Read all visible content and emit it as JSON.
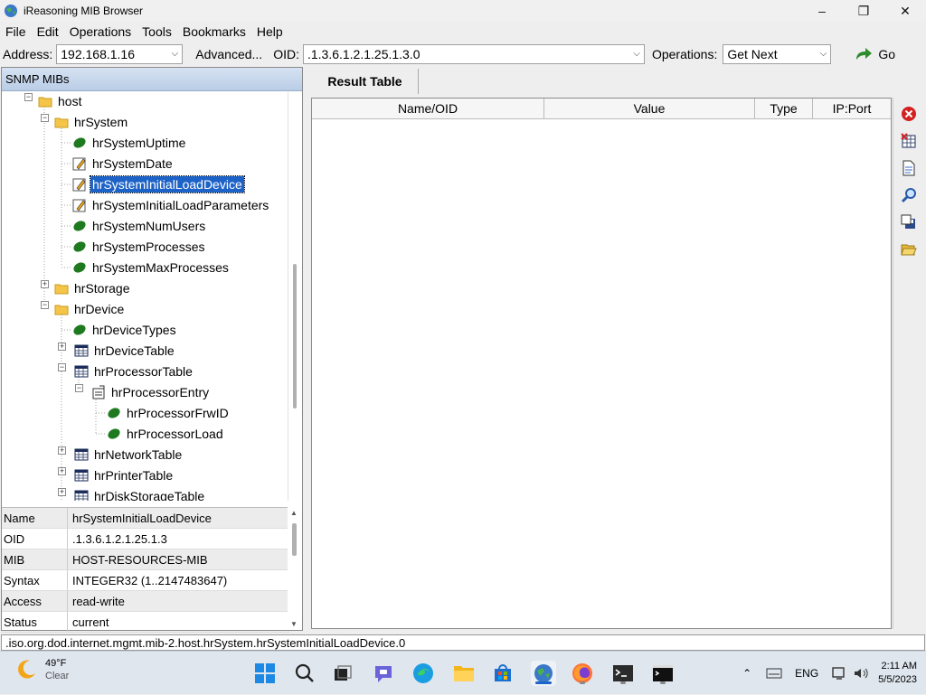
{
  "window": {
    "title": "iReasoning MIB Browser"
  },
  "menu": [
    "File",
    "Edit",
    "Operations",
    "Tools",
    "Bookmarks",
    "Help"
  ],
  "toolbar": {
    "address_label": "Address:",
    "address_value": "192.168.1.16",
    "advanced_label": "Advanced...",
    "oid_label": "OID:",
    "oid_value": ".1.3.6.1.2.1.25.1.3.0",
    "operations_label": "Operations:",
    "operations_value": "Get Next",
    "go_label": "Go"
  },
  "tree_panel": {
    "header": "SNMP MIBs",
    "nodes": [
      {
        "label": "host",
        "type": "folder"
      },
      {
        "label": "hrSystem",
        "type": "folder"
      },
      {
        "label": "hrSystemUptime",
        "type": "leaf"
      },
      {
        "label": "hrSystemDate",
        "type": "writable"
      },
      {
        "label": "hrSystemInitialLoadDevice",
        "type": "writable",
        "selected": true
      },
      {
        "label": "hrSystemInitialLoadParameters",
        "type": "writable"
      },
      {
        "label": "hrSystemNumUsers",
        "type": "leaf"
      },
      {
        "label": "hrSystemProcesses",
        "type": "leaf"
      },
      {
        "label": "hrSystemMaxProcesses",
        "type": "leaf"
      },
      {
        "label": "hrStorage",
        "type": "folder"
      },
      {
        "label": "hrDevice",
        "type": "folder"
      },
      {
        "label": "hrDeviceTypes",
        "type": "leaf"
      },
      {
        "label": "hrDeviceTable",
        "type": "table"
      },
      {
        "label": "hrProcessorTable",
        "type": "table"
      },
      {
        "label": "hrProcessorEntry",
        "type": "entry"
      },
      {
        "label": "hrProcessorFrwID",
        "type": "leaf"
      },
      {
        "label": "hrProcessorLoad",
        "type": "leaf"
      },
      {
        "label": "hrNetworkTable",
        "type": "table"
      },
      {
        "label": "hrPrinterTable",
        "type": "table"
      },
      {
        "label": "hrDiskStorageTable",
        "type": "table"
      }
    ]
  },
  "properties": [
    {
      "key": "Name",
      "value": "hrSystemInitialLoadDevice"
    },
    {
      "key": "OID",
      "value": ".1.3.6.1.2.1.25.1.3"
    },
    {
      "key": "MIB",
      "value": "HOST-RESOURCES-MIB"
    },
    {
      "key": "Syntax",
      "value": "INTEGER32 (1..2147483647)"
    },
    {
      "key": "Access",
      "value": "read-write"
    },
    {
      "key": "Status",
      "value": "current"
    }
  ],
  "result": {
    "tab": "Result Table",
    "columns": [
      "Name/OID",
      "Value",
      "Type",
      "IP:Port"
    ]
  },
  "status_bar": ".iso.org.dod.internet.mgmt.mib-2.host.hrSystem.hrSystemInitialLoadDevice.0",
  "taskbar": {
    "temp": "49°F",
    "condition": "Clear",
    "lang": "ENG",
    "time": "2:11 AM",
    "date": "5/5/2023"
  }
}
